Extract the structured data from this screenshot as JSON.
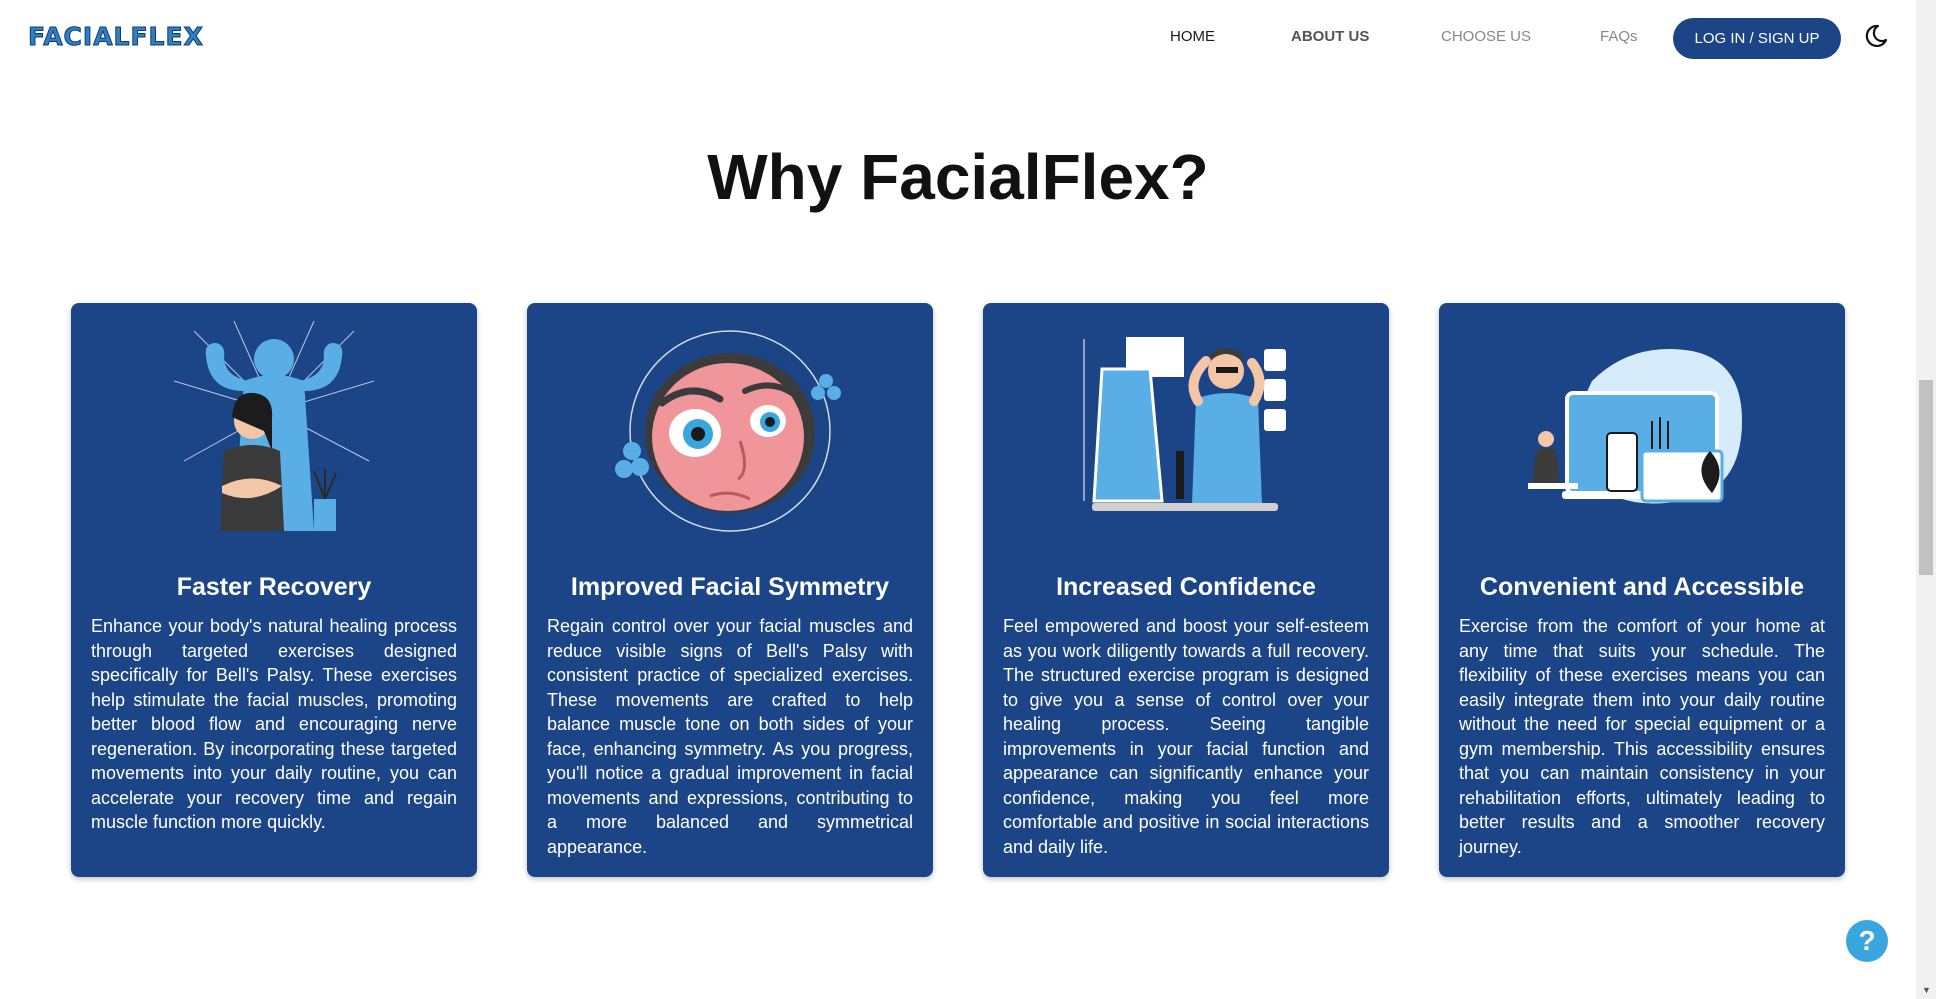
{
  "nav": {
    "logo": "FACIALFLEX",
    "links": [
      "HOME",
      "ABOUT US",
      "CHOOSE US",
      "FAQs"
    ],
    "login_label": "LOG IN / SIGN UP",
    "theme_icon": "moon-icon"
  },
  "main": {
    "title": "Why FacialFlex?",
    "cards": [
      {
        "title": "Faster Recovery",
        "text": "Enhance your body's natural healing process through targeted exercises designed specifically for Bell's Palsy. These exercises help stimulate the facial muscles, promoting better blood flow and encouraging nerve regeneration. By incorporating these targeted movements into your daily routine, you can accelerate your recovery time and regain muscle function more quickly.",
        "illustration": "strength-illustration"
      },
      {
        "title": "Improved Facial Symmetry",
        "text": "Regain control over your facial muscles and reduce visible signs of Bell's Palsy with consistent practice of specialized exercises. These movements are crafted to help balance muscle tone on both sides of your face, enhancing symmetry. As you progress, you'll notice a gradual improvement in facial movements and expressions, contributing to a more balanced and symmetrical appearance.",
        "illustration": "face-illustration"
      },
      {
        "title": "Increased Confidence",
        "text": "Feel empowered and boost your self-esteem as you work diligently towards a full recovery. The structured exercise program is designed to give you a sense of control over your healing process. Seeing tangible improvements in your facial function and appearance can significantly enhance your confidence, making you feel more comfortable and positive in social interactions and daily life.",
        "illustration": "mirror-illustration"
      },
      {
        "title": "Convenient and Accessible",
        "text": "Exercise from the comfort of your home at any time that suits your schedule. The flexibility of these exercises means you can easily integrate them into your daily routine without the need for special equipment or a gym membership. This accessibility ensures that you can maintain consistency in your rehabilitation efforts, ultimately leading to better results and a smoother recovery journey.",
        "illustration": "devices-illustration"
      }
    ]
  },
  "help": {
    "label": "?",
    "icon": "help-icon"
  },
  "colors": {
    "brand": "#1c4587",
    "accent": "#3aa6e0",
    "logo": "#2f7fc4"
  }
}
